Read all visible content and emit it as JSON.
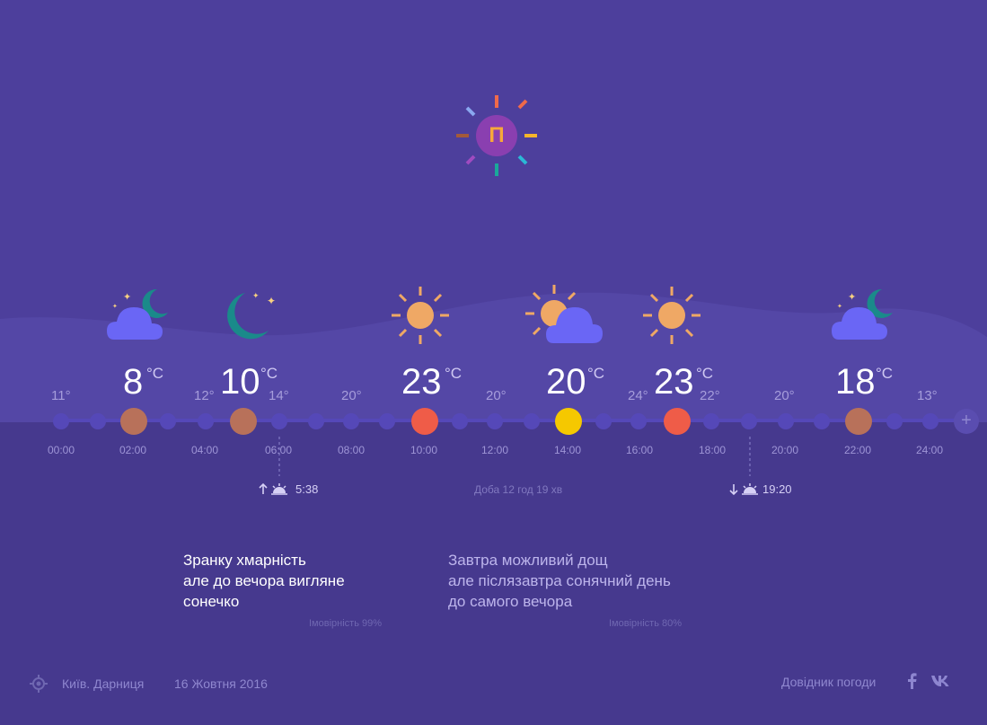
{
  "logo": {
    "letter": "П"
  },
  "peaks": [
    {
      "temp": "8",
      "unit": "°C",
      "icon": "cloud-moon-icon"
    },
    {
      "temp": "10",
      "unit": "°C",
      "icon": "moon-icon"
    },
    {
      "temp": "23",
      "unit": "°C",
      "icon": "sun-icon"
    },
    {
      "temp": "20",
      "unit": "°C",
      "icon": "sun-cloud-icon"
    },
    {
      "temp": "23",
      "unit": "°C",
      "icon": "sun-icon"
    },
    {
      "temp": "18",
      "unit": "°C",
      "icon": "cloud-moon-icon"
    }
  ],
  "small_temps": [
    "11°",
    "12°",
    "14°",
    "20°",
    "20°",
    "24°",
    "22°",
    "20°",
    "13°"
  ],
  "hours": [
    "00:00",
    "02:00",
    "04:00",
    "06:00",
    "08:00",
    "10:00",
    "12:00",
    "14:00",
    "16:00",
    "18:00",
    "20:00",
    "22:00",
    "24:00"
  ],
  "sunrise": {
    "time": "5:38",
    "icon": "sunrise-icon"
  },
  "sunset": {
    "time": "19:20",
    "icon": "sunset-icon"
  },
  "day_length": "Доба 12 год 19 хв",
  "forecast_today": {
    "lines": [
      "Зранку хмарність",
      "але до вечора вигляне",
      "сонечко"
    ],
    "probability": "Імовірність 99%"
  },
  "forecast_tomorrow": {
    "lines": [
      "Завтра можливий дощ",
      "але післязавтра сонячний день",
      "до самого вечора"
    ],
    "probability": "Імовірність 80%"
  },
  "footer": {
    "location": "Київ. Дарниця",
    "date": "16 Жовтня 2016",
    "guide_link": "Довідник погоди",
    "location_icon": "location-target-icon",
    "social": [
      "facebook-icon",
      "vk-icon"
    ]
  },
  "colors": {
    "sun": "#efa865",
    "cloud": "#6a66f5",
    "moon": "#1a8a8a",
    "dot_default": "#5548b8",
    "dot_brown": "#b8715a",
    "dot_red": "#ef5c48",
    "dot_yellow": "#f5c800"
  }
}
